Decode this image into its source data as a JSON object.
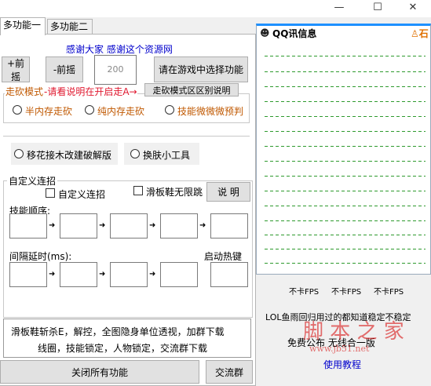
{
  "window": {
    "minimize": "—",
    "maximize": "☐",
    "close": "✕"
  },
  "tabs": [
    "多功能一",
    "多功能二"
  ],
  "thanks": "感谢大家  感谢这个资源网",
  "buttons": {
    "plus_shake": "+前摇",
    "minus_shake": "-前摇",
    "select_in_game": "请在游戏中选择功能",
    "walk_mode_diff": "走砍模式区区别说明",
    "explain": "说 明",
    "close_all": "关闭所有功能",
    "exchange_group": "交流群"
  },
  "shake_value": "200",
  "walk_mode_label": "走砍模式",
  "walk_mode_hint": "-请看说明在开启走A→",
  "radios": {
    "half_mem": "半内存走砍",
    "pure_mem": "纯内存走砍",
    "skill_predict": "技能微微微预判",
    "graft": "移花接木改建破解版",
    "skin": "换肤小工具"
  },
  "custom_combo": {
    "group_title": "自定义连招",
    "checkbox_label": "自定义连招",
    "skate_label": "滑板鞋无限跳",
    "skill_order": "技能顺序:",
    "interval": "间隔延时(ms):",
    "hotkey": "启动热键"
  },
  "footer_text": {
    "line1": "滑板鞋斩杀E，解控，全图隐身单位透视，加群下载",
    "line2": "线圈，技能锁定，人物锁定，交流群下载"
  },
  "right": {
    "qq_title": "QQ讯信息",
    "fps": [
      "不卡FPS",
      "不卡FPS",
      "不卡FPS"
    ],
    "notice": "LOL鱼雨回归用过的都知道稳定不稳定",
    "free": "免费公布    无线合一版",
    "tutorial": "使用教程"
  },
  "watermark": {
    "main": "脚 本 之 家",
    "url": "www.jb51.net"
  }
}
